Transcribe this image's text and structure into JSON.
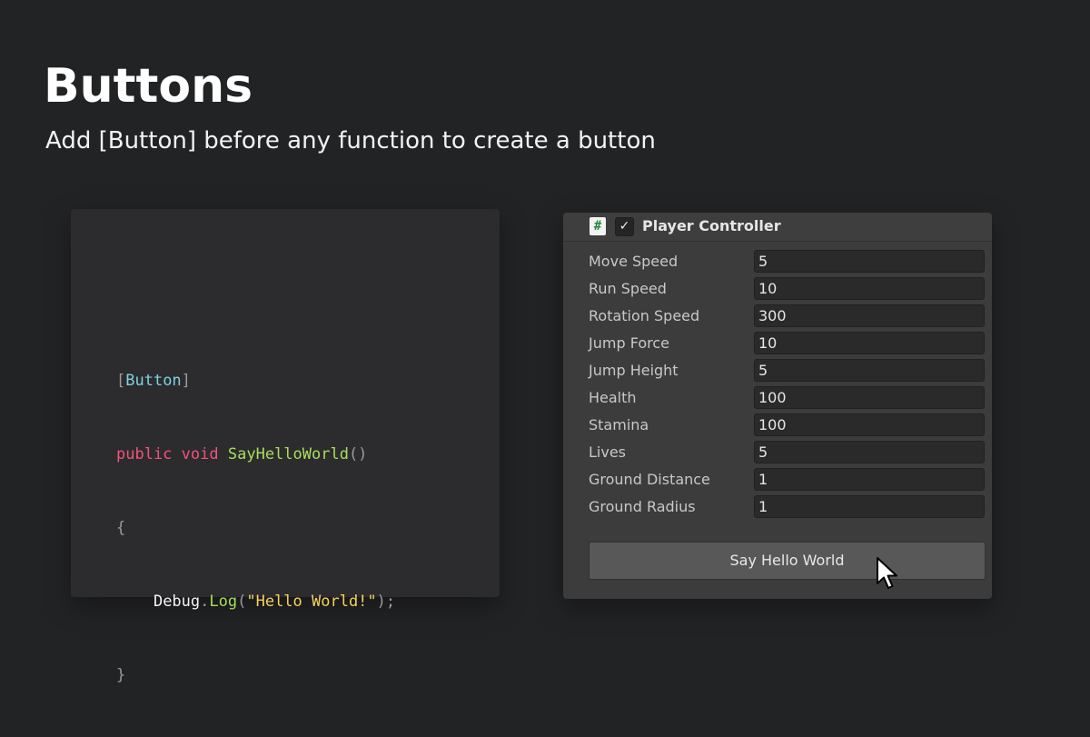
{
  "page": {
    "title": "Buttons",
    "subtitle": "Add [Button] before any function to create a button"
  },
  "code": {
    "line1": {
      "open": "[",
      "attr": "Button",
      "close": "]"
    },
    "line2": {
      "kw1": "public",
      "kw2": "void",
      "fn": "SayHelloWorld",
      "parens": "()"
    },
    "line3": {
      "brace": "{"
    },
    "line4": {
      "indent": "    ",
      "obj": "Debug",
      "dot": ".",
      "method": "Log",
      "open": "(",
      "str": "\"Hello World!\"",
      "close": ");"
    },
    "line5": {
      "brace": "}"
    }
  },
  "inspector": {
    "script_icon_glyph": "#",
    "enabled_glyph": "✓",
    "component_title": "Player Controller",
    "fields": [
      {
        "label": "Move Speed",
        "value": "5"
      },
      {
        "label": "Run Speed",
        "value": "10"
      },
      {
        "label": "Rotation Speed",
        "value": "300"
      },
      {
        "label": "Jump Force",
        "value": "10"
      },
      {
        "label": "Jump Height",
        "value": "5"
      },
      {
        "label": "Health",
        "value": "100"
      },
      {
        "label": "Stamina",
        "value": "100"
      },
      {
        "label": "Lives",
        "value": "5"
      },
      {
        "label": "Ground Distance",
        "value": "1"
      },
      {
        "label": "Ground Radius",
        "value": "1"
      }
    ],
    "button_label": "Say Hello World"
  },
  "colors": {
    "background": "#222325",
    "code_panel": "#2c2b2e",
    "inspector_panel": "#3c3c3c",
    "keyword": "#f0537a",
    "function": "#a6df5a",
    "attribute": "#7fd1e0",
    "string": "#f5d35b"
  },
  "icons": {
    "script": "csharp-script-icon",
    "checkbox": "checkmark-icon",
    "cursor": "mouse-pointer-icon"
  }
}
